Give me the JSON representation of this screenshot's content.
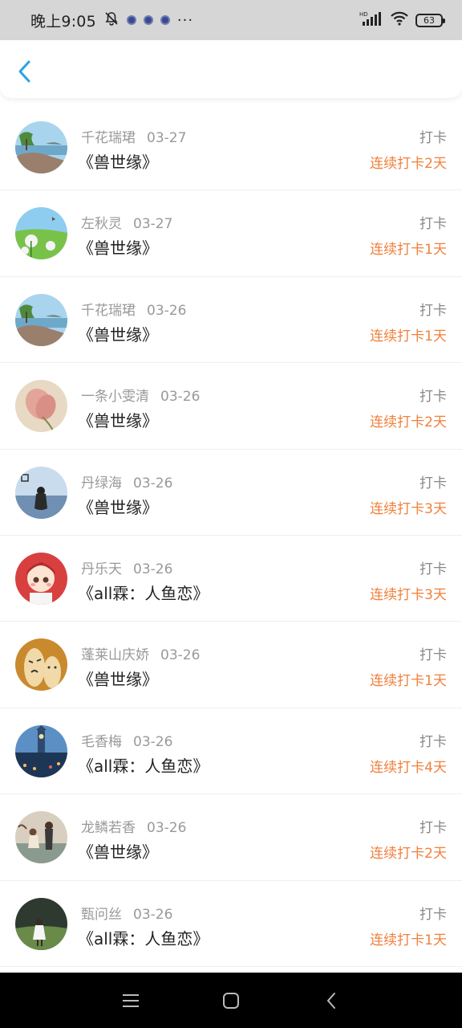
{
  "status_bar": {
    "time": "晚上9:05",
    "more": "···",
    "battery": "63",
    "network_badge": "HD"
  },
  "header": {
    "back_icon": "chevron-left-icon",
    "accent_color": "#2aa3e5"
  },
  "checkins": [
    {
      "name": "千花瑞珺",
      "date": "03-27",
      "book": "《兽世缘》",
      "action": "打卡",
      "streak": "连续打卡2天",
      "avatar": "island-seascape"
    },
    {
      "name": "左秋灵",
      "date": "03-27",
      "book": "《兽世缘》",
      "action": "打卡",
      "streak": "连续打卡1天",
      "avatar": "dandelion-meadow"
    },
    {
      "name": "千花瑞珺",
      "date": "03-26",
      "book": "《兽世缘》",
      "action": "打卡",
      "streak": "连续打卡1天",
      "avatar": "island-seascape"
    },
    {
      "name": "一条小雯清",
      "date": "03-26",
      "book": "《兽世缘》",
      "action": "打卡",
      "streak": "连续打卡2天",
      "avatar": "pink-flower"
    },
    {
      "name": "丹绿海",
      "date": "03-26",
      "book": "《兽世缘》",
      "action": "打卡",
      "streak": "连续打卡3天",
      "avatar": "girl-by-sea"
    },
    {
      "name": "丹乐天",
      "date": "03-26",
      "book": "《all霖：人鱼恋》",
      "action": "打卡",
      "streak": "连续打卡3天",
      "avatar": "cartoon-doll"
    },
    {
      "name": "蓬莱山庆娇",
      "date": "03-26",
      "book": "《兽世缘》",
      "action": "打卡",
      "streak": "连续打卡1天",
      "avatar": "finger-faces"
    },
    {
      "name": "毛香梅",
      "date": "03-26",
      "book": "《all霖：人鱼恋》",
      "action": "打卡",
      "streak": "连续打卡4天",
      "avatar": "city-night"
    },
    {
      "name": "龙鳞若香",
      "date": "03-26",
      "book": "《兽世缘》",
      "action": "打卡",
      "streak": "连续打卡2天",
      "avatar": "couple-dancing"
    },
    {
      "name": "甄问丝",
      "date": "03-26",
      "book": "《all霖：人鱼恋》",
      "action": "打卡",
      "streak": "连续打卡1天",
      "avatar": "girl-in-field"
    }
  ],
  "nav_bar": {
    "menu_icon": "menu-icon",
    "home_icon": "home-square-icon",
    "back_icon": "back-triangle-icon"
  },
  "colors": {
    "streak": "#f0803c",
    "muted_text": "#999999",
    "status_bar_bg": "#d6d6d6"
  }
}
